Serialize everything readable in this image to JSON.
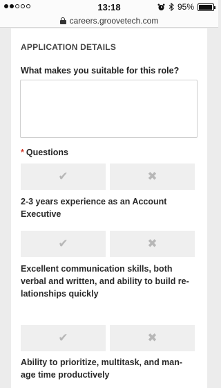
{
  "status_bar": {
    "time": "13:18",
    "battery_percent": "95%",
    "battery_level": 0.95,
    "signal_icons": [
      "signal-dot-filled",
      "signal-dot-filled",
      "signal-dot",
      "signal-dot",
      "signal-dot"
    ],
    "status_icons": [
      "alarm-clock-icon",
      "bluetooth-icon",
      "battery-icon"
    ]
  },
  "url_bar": {
    "url": "careers.groovetech.com",
    "icon": "lock-icon"
  },
  "form": {
    "section_title": "APPLICATION DETAILS",
    "suitable_label": "What makes you suitable for this role?",
    "suitable_value": "",
    "questions_required_mark": "*",
    "questions_label": "Questions",
    "yes_glyph": "✔",
    "no_glyph": "✖",
    "questions": [
      {
        "text": "2-3 years experience as an Account Executive"
      },
      {
        "text": "Excellent communication skills, both verbal and written, and ability to build re-lationships quickly"
      },
      {
        "text": "Ability to prioritize, multitask, and man-age time productively"
      }
    ]
  },
  "colors": {
    "background": "#ececec",
    "card": "#ffffff",
    "button": "#efefef",
    "icon": "#b7b7b7",
    "required": "#d0392b"
  }
}
